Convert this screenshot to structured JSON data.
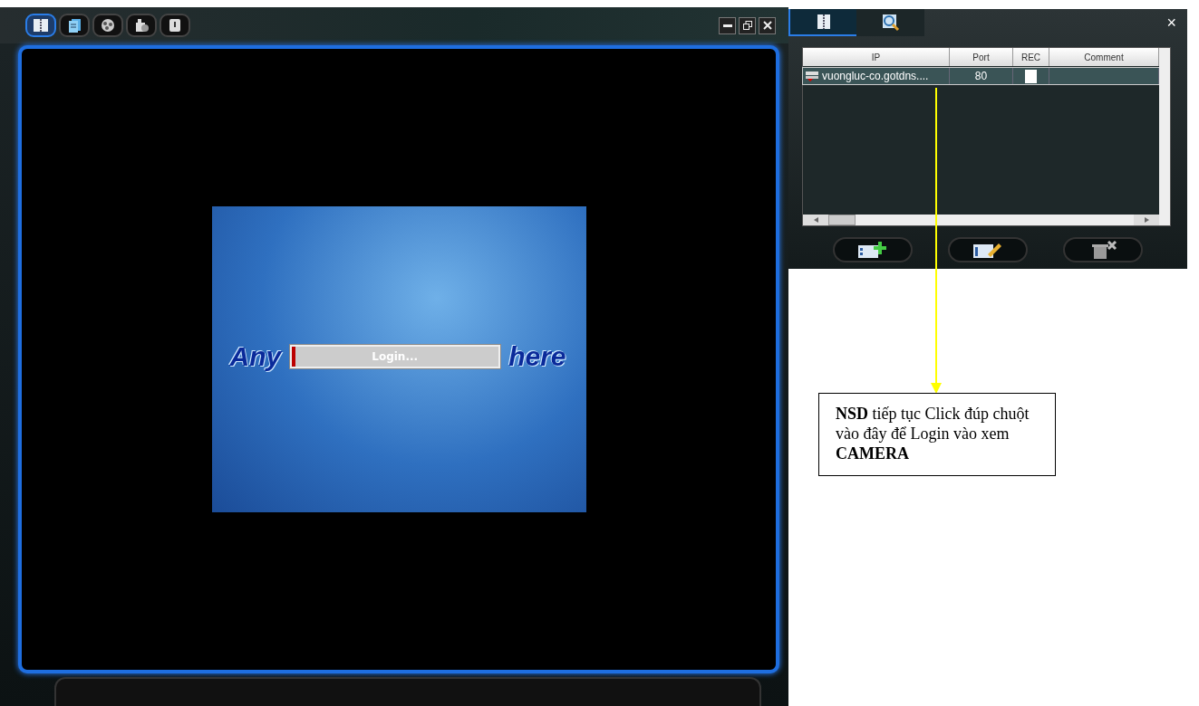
{
  "main_window": {
    "toolbar_tabs": [
      {
        "selected": true
      },
      {
        "selected": false
      },
      {
        "selected": false
      },
      {
        "selected": false
      },
      {
        "selected": false
      }
    ],
    "splash": {
      "left_text": "Any",
      "right_text": "here",
      "progress": {
        "label": "Login...",
        "level": 0.02
      }
    }
  },
  "device_panel": {
    "tabs": [
      {
        "selected": true
      },
      {
        "selected": false
      }
    ],
    "close": "×",
    "table": {
      "columns": [
        "IP",
        "Port",
        "REC",
        "Comment"
      ],
      "rows": [
        {
          "ip": "vuongluc-co.gotdns....",
          "port": "80",
          "rec": false,
          "selected": true
        }
      ]
    }
  },
  "annotation": {
    "text": "**NSD** tiếp tục Click đúp chuột vào đây để Login vào xem **CAMERA**"
  }
}
